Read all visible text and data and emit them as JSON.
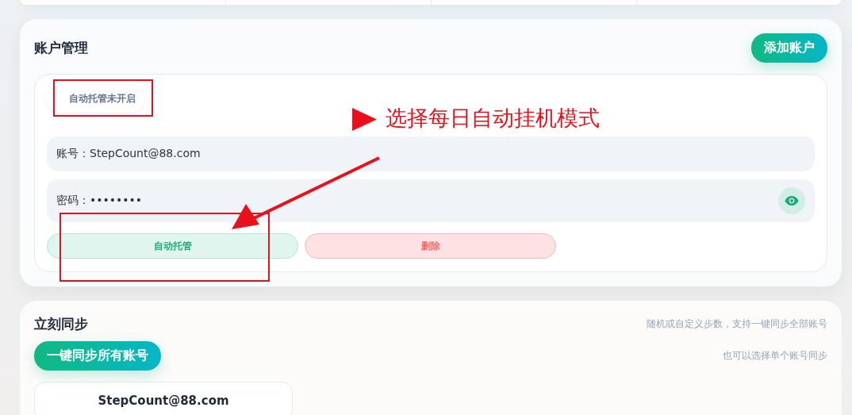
{
  "account_section": {
    "title": "账户管理",
    "add_button": "添加账户",
    "accounts": [
      {
        "status": "自动托管未开启",
        "account_label": "账号：",
        "account": "StepCount@88.com",
        "password_label": "密码：",
        "password": "••••••••",
        "auto_button": "自动托管",
        "delete_button": "删除"
      }
    ]
  },
  "sync_section": {
    "title": "立刻同步",
    "hint": "随机或自定义步数，支持一键同步全部账号",
    "sync_all_button": "一键同步所有账号",
    "sub_hint": "也可以选择单个账号同步",
    "accounts": [
      {
        "account": "StepCount@88.com"
      }
    ]
  },
  "annotation": {
    "text": "选择每日自动挂机模式"
  }
}
